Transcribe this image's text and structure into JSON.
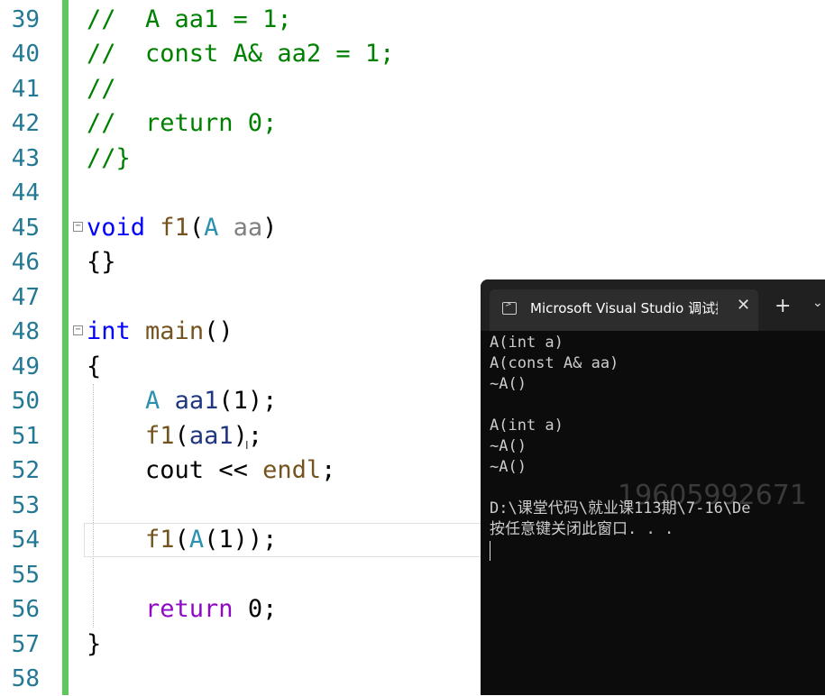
{
  "editor": {
    "line_numbers": [
      "39",
      "40",
      "41",
      "42",
      "43",
      "44",
      "45",
      "46",
      "47",
      "48",
      "49",
      "50",
      "51",
      "52",
      "53",
      "54",
      "55",
      "56",
      "57",
      "58"
    ],
    "lines": {
      "l39": "//  A aa1 = 1;",
      "l40": "//  const A& aa2 = 1;",
      "l41": "//",
      "l42": "//  return 0;",
      "l43": "//}",
      "l45_kw": "void",
      "l45_fn": "f1",
      "l45_open": "(",
      "l45_type": "A",
      "l45_param": "aa",
      "l45_close": ")",
      "l46": "{}",
      "l48_kw": "int",
      "l48_fn": "main",
      "l48_rest": "()",
      "l49": "{",
      "l50_type": "A",
      "l50_var": "aa1",
      "l50_rest": "(1);",
      "l51_fn": "f1",
      "l51_open": "(",
      "l51_var": "aa1",
      "l51_rest": ");",
      "l52_var": "cout",
      "l52_op": "<<",
      "l52_endl": "endl",
      "l52_rest": ";",
      "l54_fn": "f1",
      "l54_open": "(",
      "l54_type": "A",
      "l54_rest": "(1));",
      "l56_kw": "return",
      "l56_rest": "0;",
      "l57": "}"
    }
  },
  "console": {
    "tab_title": "Microsoft Visual Studio 调试控制台",
    "close_glyph": "✕",
    "new_tab_glyph": "+",
    "dropdown_glyph": "⌄",
    "output": [
      "A(int a)",
      "A(const A& aa)",
      "~A()",
      "",
      "A(int a)",
      "~A()",
      "~A()",
      "",
      "D:\\课堂代码\\就业课113期\\7-16\\De",
      "按任意键关闭此窗口. . ."
    ],
    "watermark": "19605992671"
  }
}
